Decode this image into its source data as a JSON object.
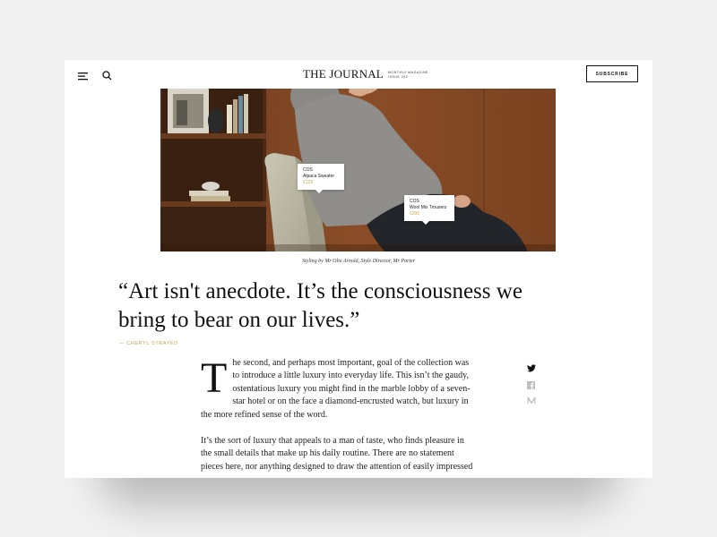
{
  "header": {
    "menu_icon": "hamburger-menu-icon",
    "search_icon": "search-icon",
    "brand_title": "THE JOURNAL",
    "brand_sub_line1": "MONTHLY MAGAZINE",
    "brand_sub_line2": "ISSUE 292",
    "subscribe_label": "SUBSCRIBE"
  },
  "hero": {
    "tags": [
      {
        "brand": "COS",
        "name": "Alpaca Sweater",
        "price": "€129"
      },
      {
        "brand": "COS",
        "name": "Wool Mix Trousers",
        "price": "€295"
      }
    ],
    "caption": "Styling by Mr Olie Arnold, Style Director, Mr Porter"
  },
  "quote": {
    "text": "“Art isn't anecdote. It’s the consciousness we bring to bear on our lives.”",
    "attribution": "— CHERYL STRAYED"
  },
  "article": {
    "dropcap": "T",
    "paragraph1": "he second, and perhaps most important, goal of the collection was to introduce a little luxury into everyday life. This isn’t the gaudy, ostentatious luxury you might find in the marble lobby of a seven-star hotel or on the face a diamond-encrusted watch, but luxury in the more refined sense of the word.",
    "paragraph2": "It’s the sort of luxury that appeals to a man of taste, who finds pleasure in the small details that make up his daily routine. There are no statement pieces here, nor anything designed to draw the attention of easily impressed"
  },
  "share": [
    "twitter-icon",
    "facebook-icon",
    "medium-icon"
  ],
  "colors": {
    "accent": "#c9a24c",
    "text": "#111111",
    "background": "#f1f1f1",
    "page": "#ffffff"
  }
}
